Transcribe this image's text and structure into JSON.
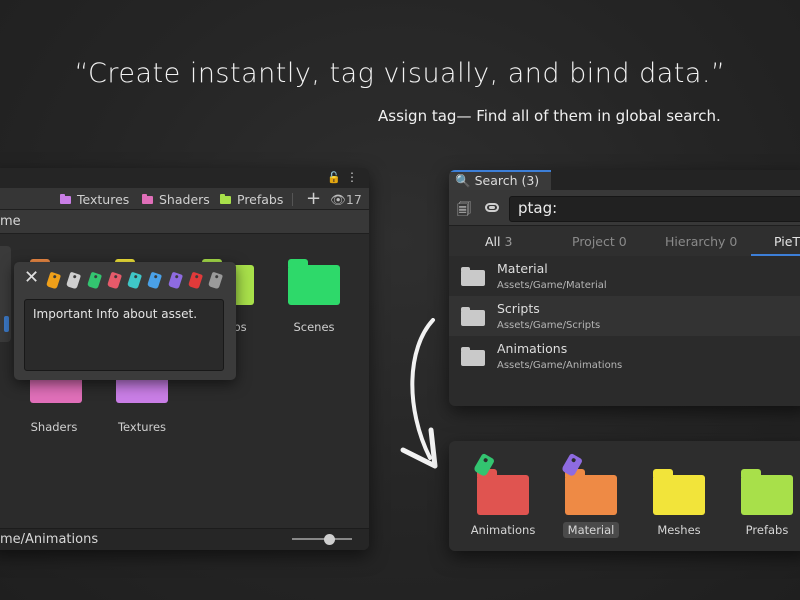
{
  "headline": "“Create instantly, tag visually, and bind data.”",
  "subline": "Assign tag— Find all of them in global search.",
  "project_window": {
    "favorites": [
      {
        "label": "Textures",
        "color": "#c97ee6"
      },
      {
        "label": "Shaders",
        "color": "#e06fb9"
      },
      {
        "label": "Prefabs",
        "color": "#a8e04a"
      }
    ],
    "eye_count": "17",
    "path": "me",
    "folders": [
      {
        "label": "bs",
        "color": "#a8e04a"
      },
      {
        "label": "Scenes",
        "color": "#2ed96a"
      },
      {
        "label": "Shaders",
        "color": "#e06fb9"
      },
      {
        "label": "Textures",
        "color": "#c97ee6"
      }
    ],
    "status_path": "me/Animations"
  },
  "tag_popup": {
    "tag_colors": [
      "#f0a019",
      "#cfcfcf",
      "#33c470",
      "#e65a6a",
      "#3fc7c7",
      "#4aa1e8",
      "#8e6be0",
      "#e03a3a",
      "#9a9a9a"
    ],
    "note": "Important Info about asset."
  },
  "search_window": {
    "tab_label": "Search (3)",
    "query": "ptag:",
    "filters": [
      {
        "label": "All",
        "count": "3",
        "active": true
      },
      {
        "label": "Project",
        "count": "0"
      },
      {
        "label": "Hierarchy",
        "count": "0"
      },
      {
        "label": "PieT",
        "count": ""
      }
    ],
    "results": [
      {
        "name": "Material",
        "path": "Assets/Game/Material"
      },
      {
        "name": "Scripts",
        "path": "Assets/Game/Scripts"
      },
      {
        "name": "Animations",
        "path": "Assets/Game/Animations"
      }
    ]
  },
  "folder_panel": {
    "folders": [
      {
        "label": "Animations",
        "color": "#e05450",
        "tag_color": "#33c470"
      },
      {
        "label": "Material",
        "color": "#ee8a45",
        "tag_color": "#8e6be0",
        "selected": true
      },
      {
        "label": "Meshes",
        "color": "#f2e43a"
      },
      {
        "label": "Prefabs",
        "color": "#a8e04a"
      }
    ]
  }
}
